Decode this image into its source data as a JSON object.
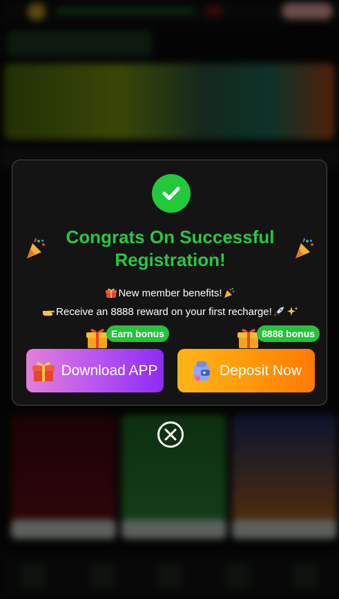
{
  "modal": {
    "title": "Congrats On Successful Registration!",
    "benefits_line": "New member benefits!",
    "reward_line": "Receive an 8888 reward on your first recharge!",
    "download_button": {
      "label": "Download APP",
      "badge": "Earn bonus"
    },
    "deposit_button": {
      "label": "Deposit Now",
      "badge": "8888 bonus"
    }
  },
  "icons": {
    "success": "check-circle-icon",
    "celebrate": "party-popper-icon",
    "gift": "gift-icon",
    "hand": "pointing-hand-icon",
    "rocket": "rocket-icon",
    "sparkles": "sparkles-icon",
    "wallet": "wallet-icon",
    "close": "close-circle-icon"
  },
  "colors": {
    "success_green": "#22c93a",
    "title_green": "#27c93f",
    "download_gradient": [
      "#e37fdb",
      "#8b2cf4"
    ],
    "deposit_gradient": [
      "#ffb516",
      "#ff7a02"
    ],
    "badge_green": "#25c23a"
  }
}
